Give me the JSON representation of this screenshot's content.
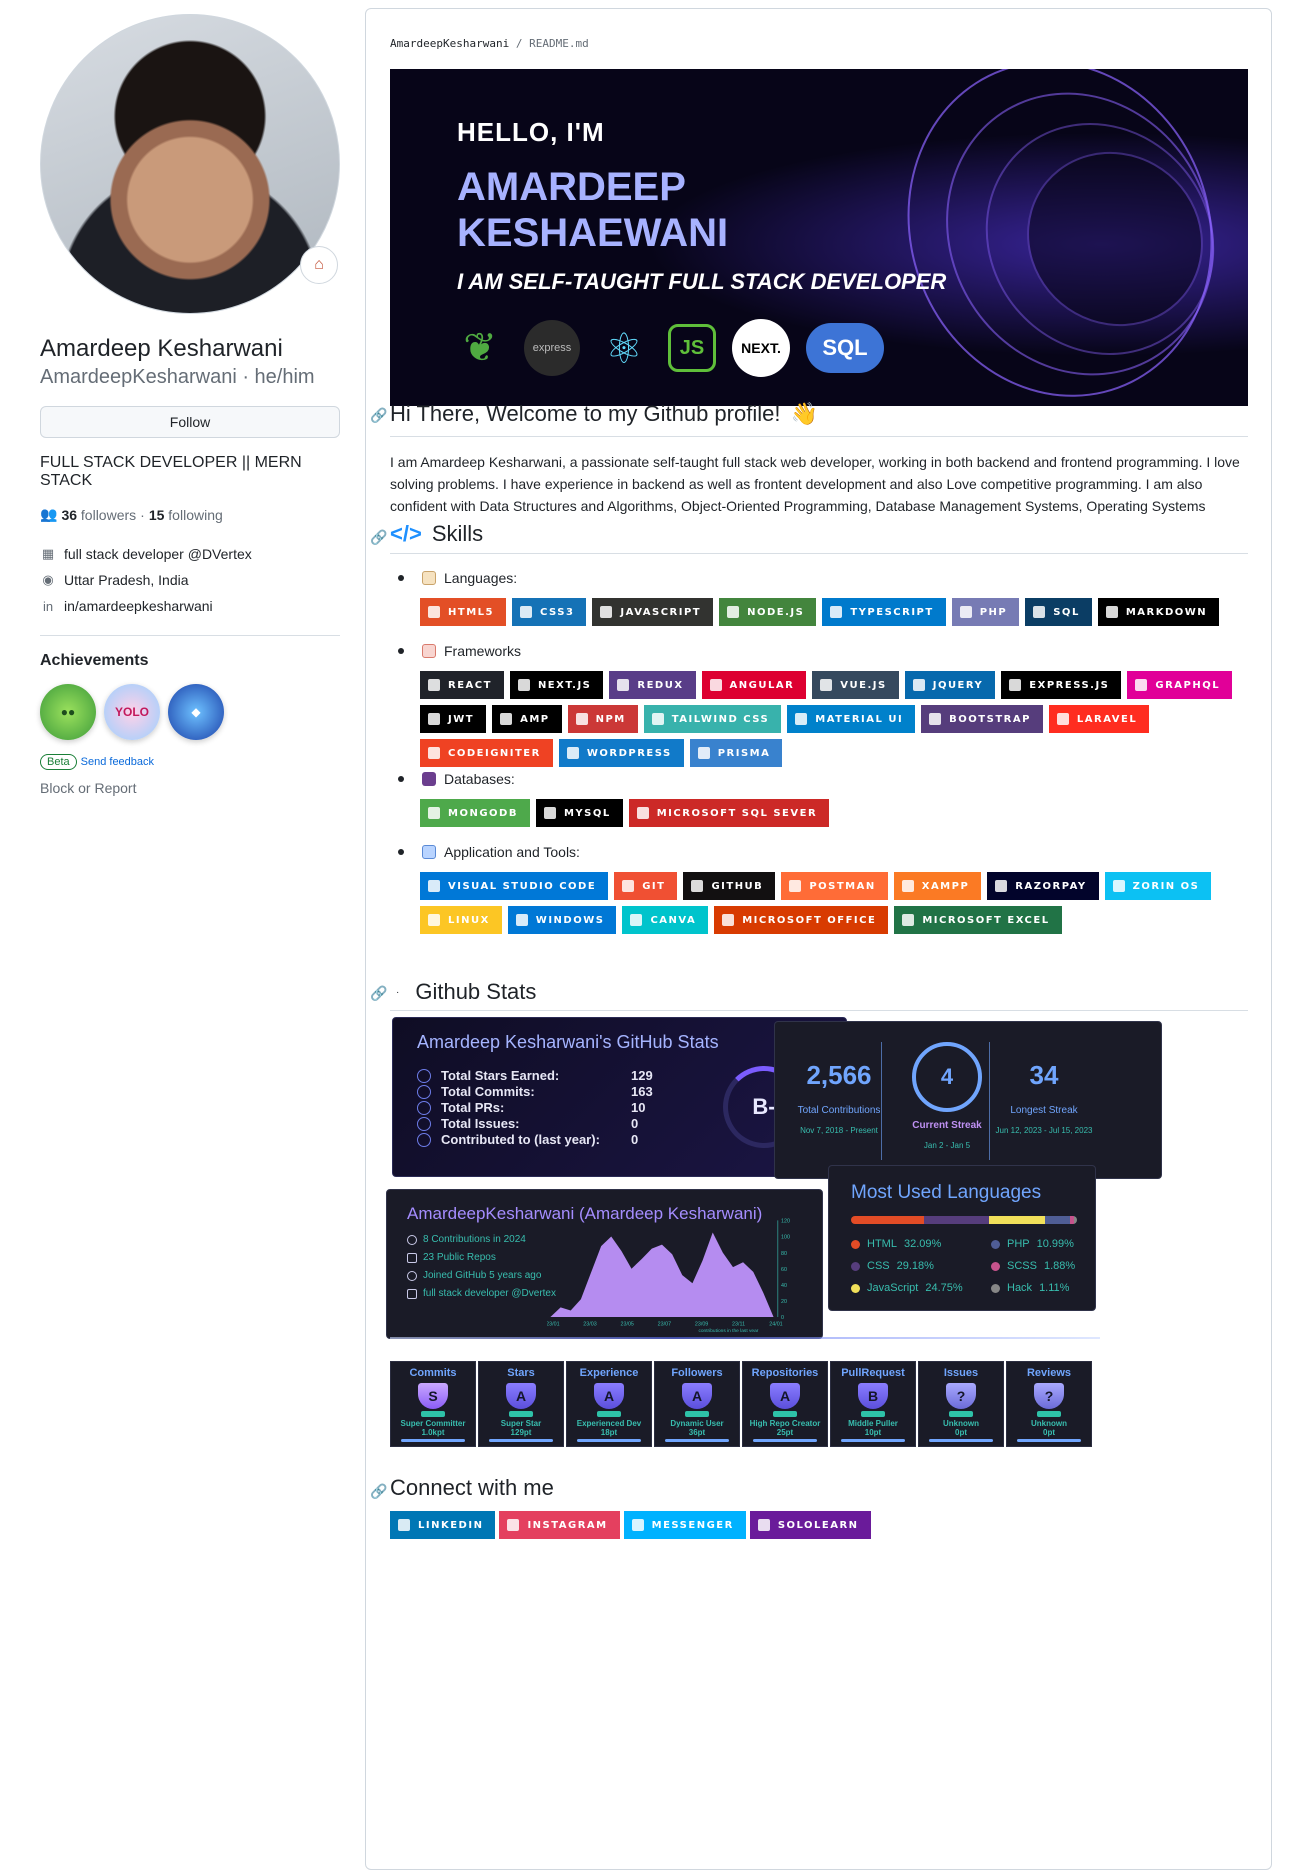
{
  "sidebar": {
    "full_name": "Amardeep Kesharwani",
    "login": "AmardeepKesharwani · he/him",
    "follow_label": "Follow",
    "bio": "FULL STACK DEVELOPER || MERN STACK",
    "followers_count": "36",
    "followers_label": "followers",
    "following_count": "15",
    "following_label": "following",
    "company": "full stack developer @DVertex",
    "location": "Uttar Pradesh, India",
    "linkedin": "in/amardeepkesharwani",
    "achievements_title": "Achievements",
    "beta_label": "Beta",
    "feedback_label": "Send feedback",
    "block_label": "Block or Report"
  },
  "readme": {
    "breadcrumb_user": "AmardeepKesharwani",
    "breadcrumb_sep": "/",
    "breadcrumb_file": "README.md",
    "banner": {
      "hello": "HELLO, I'M",
      "name_line1": "AMARDEEP",
      "name_line2": "KESHAEWANI",
      "tagline": "I AM SELF-TAUGHT FULL STACK DEVELOPER",
      "tech_express": "express",
      "tech_js": "JS",
      "tech_next": "NEXT.",
      "tech_sql": "SQL"
    },
    "welcome_heading": "Hi There, Welcome to my Github profile!",
    "intro": "I am Amardeep Kesharwani, a passionate self-taught full stack web developer, working in both backend and frontend programming. I love solving problems. I have experience in backend as well as frontent development and also Love competitive programming. I am also confident with Data Structures and Algorithms, Object-Oriented Programming, Database Management Systems, Operating Systems",
    "skills_heading": "Skills",
    "languages_label": "Languages:",
    "frameworks_label": "Frameworks",
    "databases_label": "Databases:",
    "tools_label": "Application and Tools:",
    "languages": [
      {
        "label": "HTML5",
        "color": "#e34f26"
      },
      {
        "label": "CSS3",
        "color": "#1572b6"
      },
      {
        "label": "JAVASCRIPT",
        "color": "#323330"
      },
      {
        "label": "NODE.JS",
        "color": "#43853d"
      },
      {
        "label": "TYPESCRIPT",
        "color": "#007acc"
      },
      {
        "label": "PHP",
        "color": "#777bb4"
      },
      {
        "label": "SQL",
        "color": "#0b3d64"
      },
      {
        "label": "MARKDOWN",
        "color": "#000000"
      }
    ],
    "frameworks": [
      {
        "label": "REACT",
        "color": "#20232a"
      },
      {
        "label": "NEXT.JS",
        "color": "#000000"
      },
      {
        "label": "REDUX",
        "color": "#593d88"
      },
      {
        "label": "ANGULAR",
        "color": "#dd0031"
      },
      {
        "label": "VUE.JS",
        "color": "#35495e"
      },
      {
        "label": "JQUERY",
        "color": "#0769ad"
      },
      {
        "label": "EXPRESS.JS",
        "color": "#000000"
      },
      {
        "label": "GRAPHQL",
        "color": "#e10098"
      },
      {
        "label": "JWT",
        "color": "#000000"
      },
      {
        "label": "AMP",
        "color": "#000000"
      },
      {
        "label": "NPM",
        "color": "#cb3837"
      },
      {
        "label": "TAILWIND CSS",
        "color": "#38b2ac"
      },
      {
        "label": "MATERIAL UI",
        "color": "#0081cb"
      },
      {
        "label": "BOOTSTRAP",
        "color": "#563d7c"
      },
      {
        "label": "LARAVEL",
        "color": "#ff2d20"
      },
      {
        "label": "CODEIGNITER",
        "color": "#ef4223"
      },
      {
        "label": "WORDPRESS",
        "color": "#117ac9"
      },
      {
        "label": "PRISMA",
        "color": "#3982ce"
      }
    ],
    "databases": [
      {
        "label": "MONGODB",
        "color": "#4ea94b"
      },
      {
        "label": "MYSQL",
        "color": "#000000"
      },
      {
        "label": "MICROSOFT SQL SEVER",
        "color": "#cc2927"
      }
    ],
    "tools": [
      {
        "label": "VISUAL STUDIO CODE",
        "color": "#0078d7"
      },
      {
        "label": "GIT",
        "color": "#f05033"
      },
      {
        "label": "GITHUB",
        "color": "#121011"
      },
      {
        "label": "POSTMAN",
        "color": "#ff6c37"
      },
      {
        "label": "XAMPP",
        "color": "#fb7a24"
      },
      {
        "label": "RAZORPAY",
        "color": "#02042b"
      },
      {
        "label": "ZORIN OS",
        "color": "#0cc1f3"
      },
      {
        "label": "LINUX",
        "color": "#fcc624"
      },
      {
        "label": "WINDOWS",
        "color": "#0078d6"
      },
      {
        "label": "CANVA",
        "color": "#00c4cc"
      },
      {
        "label": "MICROSOFT OFFICE",
        "color": "#d83b01"
      },
      {
        "label": "MICROSOFT EXCEL",
        "color": "#217346"
      }
    ],
    "stats_heading": "Github Stats",
    "connect_heading": "Connect with me",
    "connect": [
      {
        "label": "LINKEDIN",
        "color": "#0077b5"
      },
      {
        "label": "INSTAGRAM",
        "color": "#e4405f"
      },
      {
        "label": "MESSENGER",
        "color": "#00b2ff"
      },
      {
        "label": "SOLOLEARN",
        "color": "#6a1b9a"
      }
    ]
  },
  "stats_card": {
    "title": "Amardeep Kesharwani's GitHub Stats",
    "rows": [
      {
        "label": "Total Stars Earned:",
        "value": "129"
      },
      {
        "label": "Total Commits:",
        "value": "163"
      },
      {
        "label": "Total PRs:",
        "value": "10"
      },
      {
        "label": "Total Issues:",
        "value": "0"
      },
      {
        "label": "Contributed to (last year):",
        "value": "0"
      }
    ],
    "grade": "B-"
  },
  "streak_card": {
    "total": "2,566",
    "total_label": "Total Contributions",
    "total_range": "Nov 7, 2018 - Present",
    "current": "4",
    "current_label": "Current Streak",
    "current_range": "Jan 2 - Jan 5",
    "longest": "34",
    "longest_label": "Longest Streak",
    "longest_range": "Jun 12, 2023 - Jul 15, 2023"
  },
  "profile_card": {
    "title": "AmardeepKesharwani (Amardeep Kesharwani)",
    "items": [
      "8 Contributions in 2024",
      "23 Public Repos",
      "Joined GitHub 5 years ago",
      "full stack developer @Dvertex"
    ],
    "chart_caption": "contributions in the last year"
  },
  "chart_data": {
    "type": "area",
    "title": "",
    "xlabel": "contributions in the last year",
    "ylabel": "",
    "categories": [
      "23/01",
      "23/03",
      "23/05",
      "23/07",
      "23/09",
      "23/11",
      "24/01"
    ],
    "ylim": [
      0,
      120
    ],
    "y_ticks": [
      "120",
      "100",
      "80",
      "60",
      "40",
      "20",
      "0"
    ],
    "values": [
      0,
      12,
      8,
      22,
      55,
      88,
      100,
      82,
      60,
      72,
      85,
      90,
      78,
      52,
      42,
      70,
      105,
      80,
      62,
      68,
      56,
      30,
      0
    ],
    "color": "#b58cf0"
  },
  "lang_card": {
    "title": "Most Used Languages",
    "langs": [
      {
        "name": "HTML",
        "pct": "32.09%",
        "value": 32.09,
        "color": "#e34c26"
      },
      {
        "name": "CSS",
        "pct": "29.18%",
        "value": 29.18,
        "color": "#563d7c"
      },
      {
        "name": "JavaScript",
        "pct": "24.75%",
        "value": 24.75,
        "color": "#f1e05a"
      },
      {
        "name": "PHP",
        "pct": "10.99%",
        "value": 10.99,
        "color": "#4f5d95"
      },
      {
        "name": "SCSS",
        "pct": "1.88%",
        "value": 1.88,
        "color": "#c6538c"
      },
      {
        "name": "Hack",
        "pct": "1.11%",
        "value": 1.11,
        "color": "#878787"
      }
    ]
  },
  "trophies": [
    {
      "title": "Commits",
      "rank": "S",
      "label": "Super Committer",
      "points": "1.0kpt"
    },
    {
      "title": "Stars",
      "rank": "A",
      "label": "Super Star",
      "points": "129pt"
    },
    {
      "title": "Experience",
      "rank": "A",
      "label": "Experienced Dev",
      "points": "18pt"
    },
    {
      "title": "Followers",
      "rank": "A",
      "label": "Dynamic User",
      "points": "36pt"
    },
    {
      "title": "Repositories",
      "rank": "A",
      "label": "High Repo Creator",
      "points": "25pt"
    },
    {
      "title": "PullRequest",
      "rank": "B",
      "label": "Middle Puller",
      "points": "10pt"
    },
    {
      "title": "Issues",
      "rank": "?",
      "label": "Unknown",
      "points": "0pt"
    },
    {
      "title": "Reviews",
      "rank": "?",
      "label": "Unknown",
      "points": "0pt"
    }
  ]
}
